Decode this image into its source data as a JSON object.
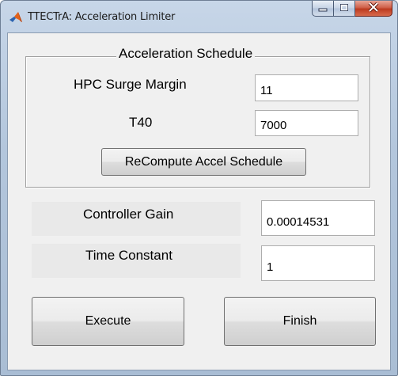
{
  "window": {
    "title": "TTECTrA: Acceleration Limiter",
    "app_icon": "matlab-icon",
    "controls": {
      "minimize_icon": "minimize-icon",
      "maximize_icon": "maximize-icon",
      "close_icon": "close-icon"
    }
  },
  "schedule": {
    "title": "Acceleration Schedule",
    "surge_margin_label": "HPC Surge Margin",
    "surge_margin_value": "11",
    "t40_label": "T40",
    "t40_value": "7000",
    "recompute_label": "ReCompute Accel Schedule"
  },
  "controller": {
    "gain_label": "Controller Gain",
    "gain_value": "0.00014531",
    "time_constant_label": "Time Constant",
    "time_constant_value": "1"
  },
  "actions": {
    "execute_label": "Execute",
    "finish_label": "Finish"
  }
}
